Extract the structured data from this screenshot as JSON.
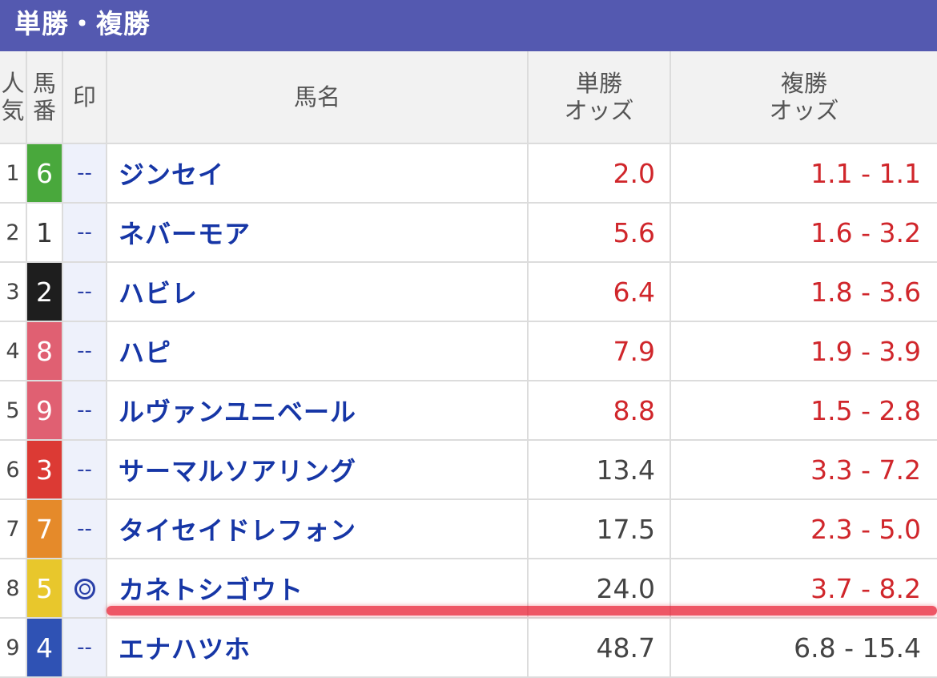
{
  "title": "単勝・複勝",
  "columns": {
    "popularity": "人\n気",
    "number": "馬\n番",
    "mark": "印",
    "horse_name": "馬名",
    "win_odds": "単勝\nオッズ",
    "place_odds": "複勝\nオッズ"
  },
  "rows": [
    {
      "rank": "1",
      "num": "6",
      "num_bg": "#49a83c",
      "num_fg": "#ffffff",
      "mark": "--",
      "mark_type": "dash",
      "name": "ジンセイ",
      "win": "2.0",
      "win_color": "#d0262b",
      "place": "1.1 - 1.1",
      "place_color": "#d0262b"
    },
    {
      "rank": "2",
      "num": "1",
      "num_bg": "#ffffff",
      "num_fg": "#333333",
      "mark": "--",
      "mark_type": "dash",
      "name": "ネバーモア",
      "win": "5.6",
      "win_color": "#d0262b",
      "place": "1.6 - 3.2",
      "place_color": "#d0262b"
    },
    {
      "rank": "3",
      "num": "2",
      "num_bg": "#1e1e1e",
      "num_fg": "#ffffff",
      "mark": "--",
      "mark_type": "dash",
      "name": "ハビレ",
      "win": "6.4",
      "win_color": "#d0262b",
      "place": "1.8 - 3.6",
      "place_color": "#d0262b"
    },
    {
      "rank": "4",
      "num": "8",
      "num_bg": "#e06072",
      "num_fg": "#ffffff",
      "mark": "--",
      "mark_type": "dash",
      "name": "ハピ",
      "win": "7.9",
      "win_color": "#d0262b",
      "place": "1.9 - 3.9",
      "place_color": "#d0262b"
    },
    {
      "rank": "5",
      "num": "9",
      "num_bg": "#e06072",
      "num_fg": "#ffffff",
      "mark": "--",
      "mark_type": "dash",
      "name": "ルヴァンユニベール",
      "win": "8.8",
      "win_color": "#d0262b",
      "place": "1.5 - 2.8",
      "place_color": "#d0262b"
    },
    {
      "rank": "6",
      "num": "3",
      "num_bg": "#dc3a34",
      "num_fg": "#ffffff",
      "mark": "--",
      "mark_type": "dash",
      "name": "サーマルソアリング",
      "win": "13.4",
      "win_color": "#444444",
      "place": "3.3 - 7.2",
      "place_color": "#d0262b"
    },
    {
      "rank": "7",
      "num": "7",
      "num_bg": "#e58a2a",
      "num_fg": "#ffffff",
      "mark": "--",
      "mark_type": "dash",
      "name": "タイセイドレフォン",
      "win": "17.5",
      "win_color": "#444444",
      "place": "2.3 - 5.0",
      "place_color": "#d0262b"
    },
    {
      "rank": "8",
      "num": "5",
      "num_bg": "#e8c72c",
      "num_fg": "#ffffff",
      "mark": "◎",
      "mark_type": "double-circle",
      "name": "カネトシゴウト",
      "win": "24.0",
      "win_color": "#444444",
      "place": "3.7 - 8.2",
      "place_color": "#d0262b"
    },
    {
      "rank": "9",
      "num": "4",
      "num_bg": "#2f52b4",
      "num_fg": "#ffffff",
      "mark": "--",
      "mark_type": "dash",
      "name": "エナハツホ",
      "win": "48.7",
      "win_color": "#444444",
      "place": "6.8 - 15.4",
      "place_color": "#444444"
    }
  ],
  "highlight_color": "#e81e32"
}
